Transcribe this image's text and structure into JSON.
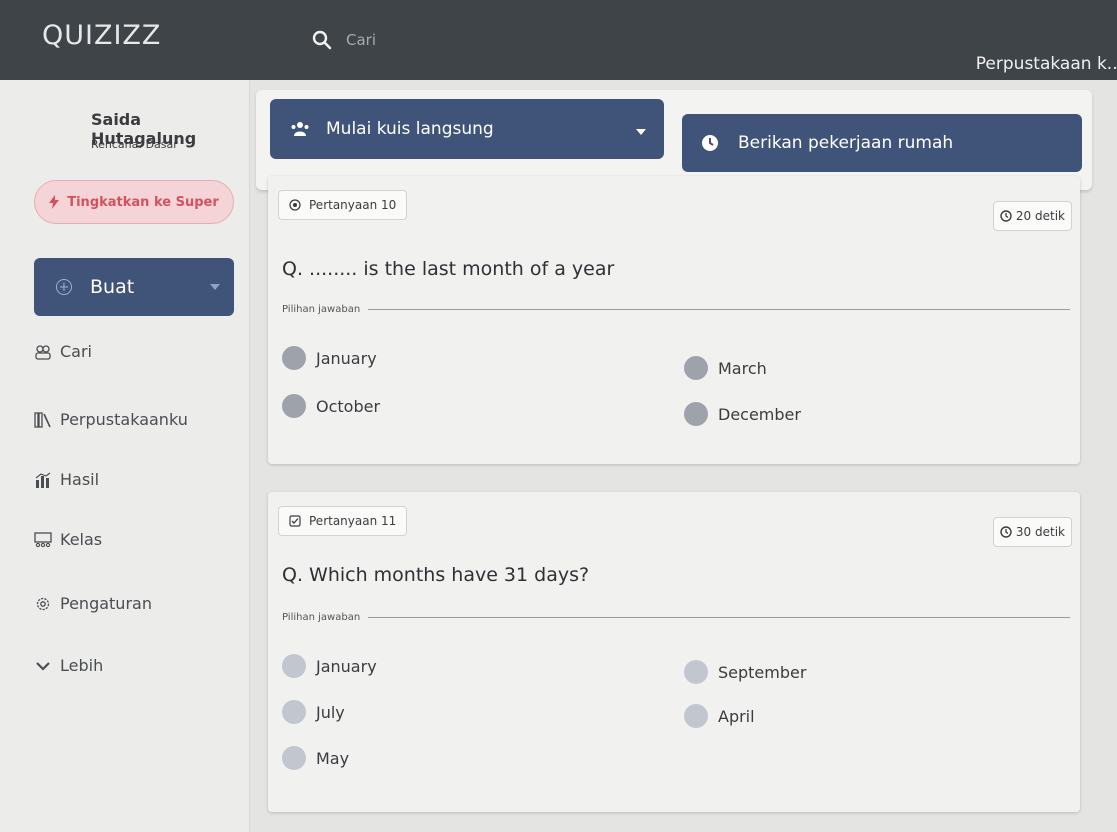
{
  "header": {
    "logo": "QUIZIZZ",
    "search_placeholder": "Cari",
    "right_link": "Perpustakaan k..."
  },
  "sidebar": {
    "user_name": "Saida Hutagalung",
    "plan": "Rencana: Dasar",
    "upgrade_label": "Tingkatkan ke Super",
    "create_label": "Buat",
    "nav": [
      {
        "label": "Cari",
        "icon": "search-people-icon"
      },
      {
        "label": "Perpustakaanku",
        "icon": "library-icon"
      },
      {
        "label": "Hasil",
        "icon": "chart-icon"
      },
      {
        "label": "Kelas",
        "icon": "classroom-icon"
      },
      {
        "label": "Pengaturan",
        "icon": "gear-icon"
      },
      {
        "label": "Lebih",
        "icon": "chevron-down-icon"
      }
    ]
  },
  "actions": {
    "live_quiz": "Mulai kuis langsung",
    "homework": "Berikan pekerjaan rumah"
  },
  "questions": [
    {
      "tag": "Pertanyaan 10",
      "time": "20 detik",
      "text": "Q. ........ is the last month of a year",
      "answers_label": "Pilihan jawaban",
      "options": [
        "January",
        "March",
        "October",
        "December"
      ]
    },
    {
      "tag": "Pertanyaan 11",
      "time": "30 detik",
      "text": "Q. Which months have 31 days?",
      "answers_label": "Pilihan jawaban",
      "options": [
        "January",
        "September",
        "July",
        "April",
        "May"
      ]
    }
  ],
  "colors": {
    "topbar": "#3f4448",
    "primary_button": "#3f5478",
    "upgrade_text": "#d2535f",
    "upgrade_bg": "#f4d4d6"
  }
}
